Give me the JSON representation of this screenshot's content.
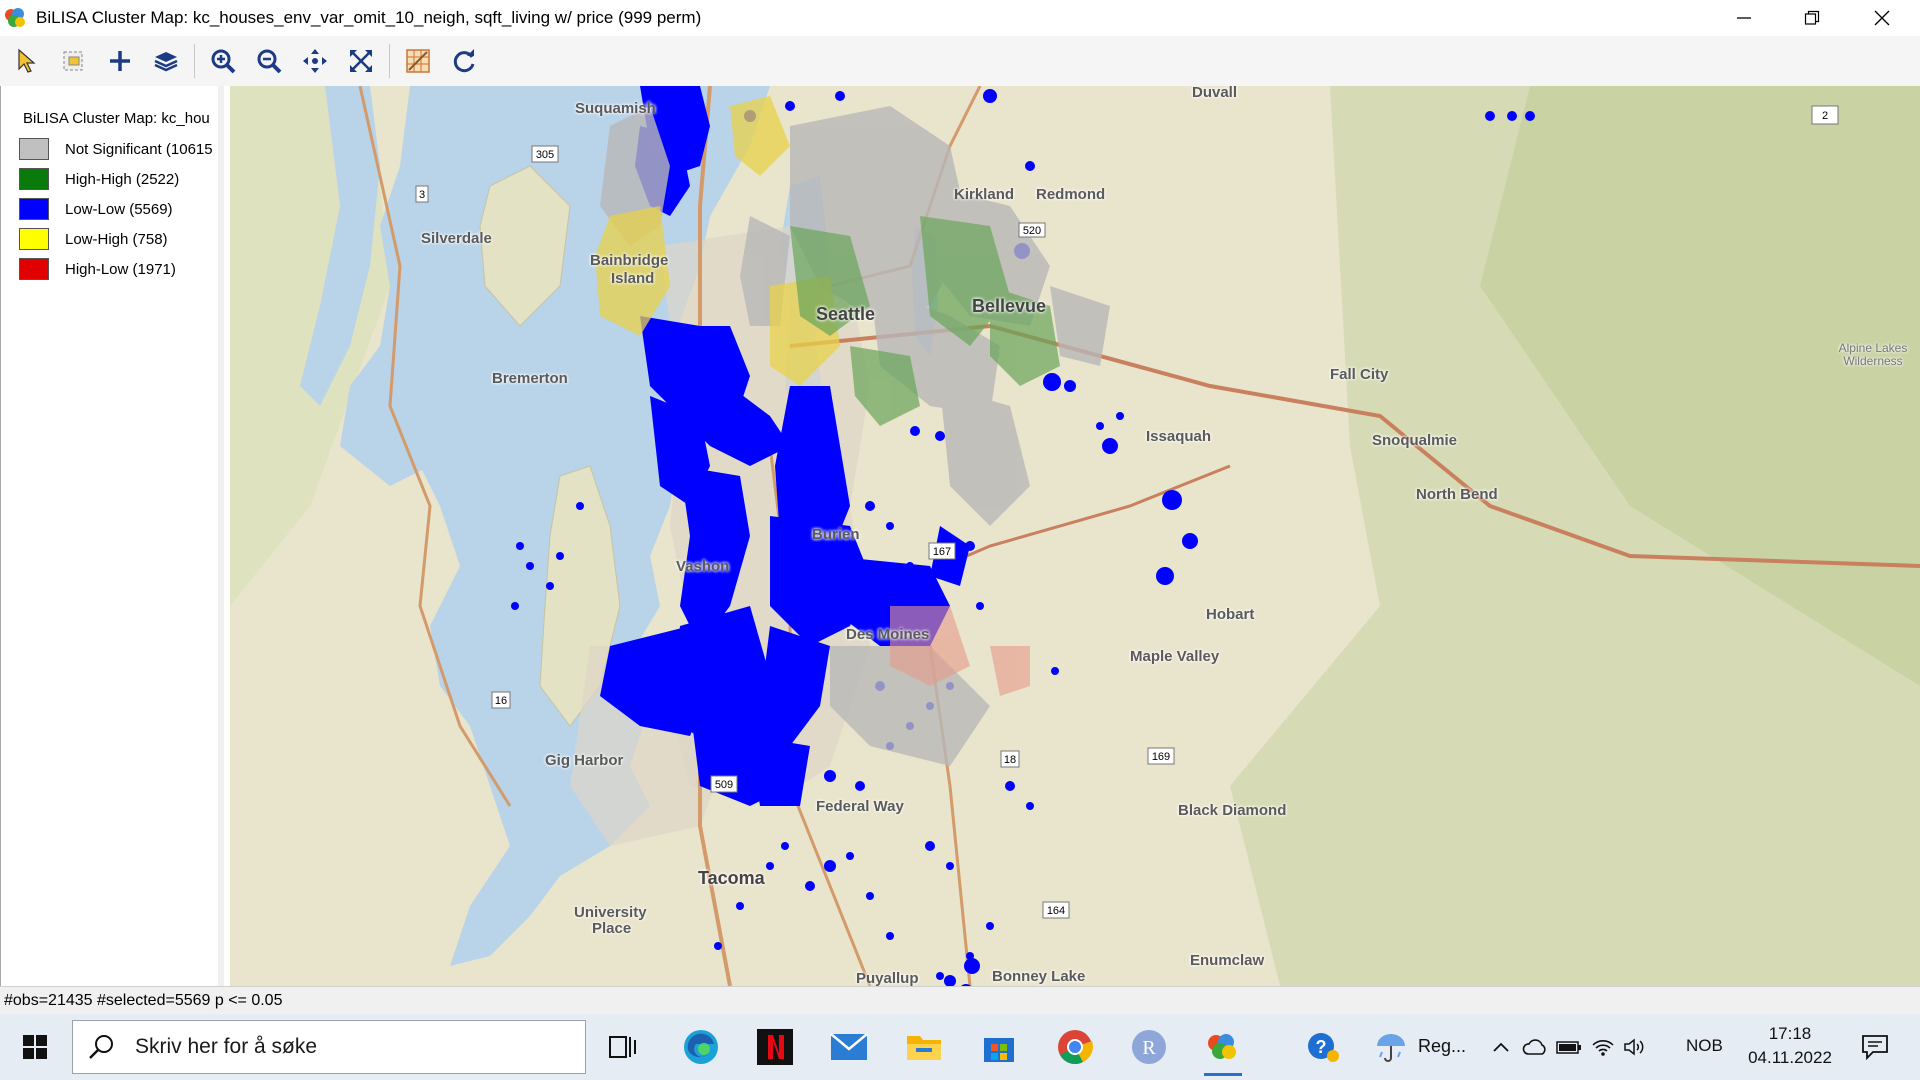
{
  "window": {
    "title": "BiLISA Cluster Map: kc_houses_env_var_omit_10_neigh, sqft_living w/ price (999 perm)"
  },
  "toolbar": {
    "tools": [
      "select-tool",
      "selection-shape-tool",
      "add-tool",
      "layers-tool",
      "zoom-in-tool",
      "zoom-out-tool",
      "pan-tool",
      "full-extent-tool",
      "basemap-tool",
      "refresh-tool"
    ]
  },
  "legend": {
    "title": "BiLISA Cluster Map: kc_hou",
    "items": [
      {
        "label": "Not Significant (10615",
        "color": "#c0c0c0"
      },
      {
        "label": "High-High (2522)",
        "color": "#0a7a0a"
      },
      {
        "label": "Low-Low (5569)",
        "color": "#0000ff"
      },
      {
        "label": "Low-High (758)",
        "color": "#ffff00"
      },
      {
        "label": "High-Low (1971)",
        "color": "#e00000"
      }
    ]
  },
  "map": {
    "places": [
      {
        "name": "Suquamish"
      },
      {
        "name": "Duvall"
      },
      {
        "name": "Kirkland"
      },
      {
        "name": "Redmond"
      },
      {
        "name": "Silverdale"
      },
      {
        "name": "Bainbridge"
      },
      {
        "name": "Island"
      },
      {
        "name": "Seattle"
      },
      {
        "name": "Bellevue"
      },
      {
        "name": "Bremerton"
      },
      {
        "name": "Fall City"
      },
      {
        "name": "Issaquah"
      },
      {
        "name": "Snoqualmie"
      },
      {
        "name": "North Bend"
      },
      {
        "name": "Vashon"
      },
      {
        "name": "Burien"
      },
      {
        "name": "Hobart"
      },
      {
        "name": "Des Moines"
      },
      {
        "name": "Maple Valley"
      },
      {
        "name": "Gig Harbor"
      },
      {
        "name": "Federal Way"
      },
      {
        "name": "Black Diamond"
      },
      {
        "name": "Tacoma"
      },
      {
        "name": "University"
      },
      {
        "name": "Place"
      },
      {
        "name": "Enumclaw"
      },
      {
        "name": "Puyallup"
      },
      {
        "name": "Bonney Lake"
      },
      {
        "name": "Alpine Lakes Wilderness"
      }
    ],
    "shields": [
      "305",
      "3",
      "2",
      "520",
      "16",
      "509",
      "18",
      "169",
      "164",
      "167"
    ]
  },
  "status": {
    "text": "#obs=21435 #selected=5569  p <= 0.05"
  },
  "taskbar": {
    "search_placeholder": "Skriv her for å søke",
    "weather_label": "Reg...",
    "language": "NOB",
    "time": "17:18",
    "date": "04.11.2022"
  }
}
